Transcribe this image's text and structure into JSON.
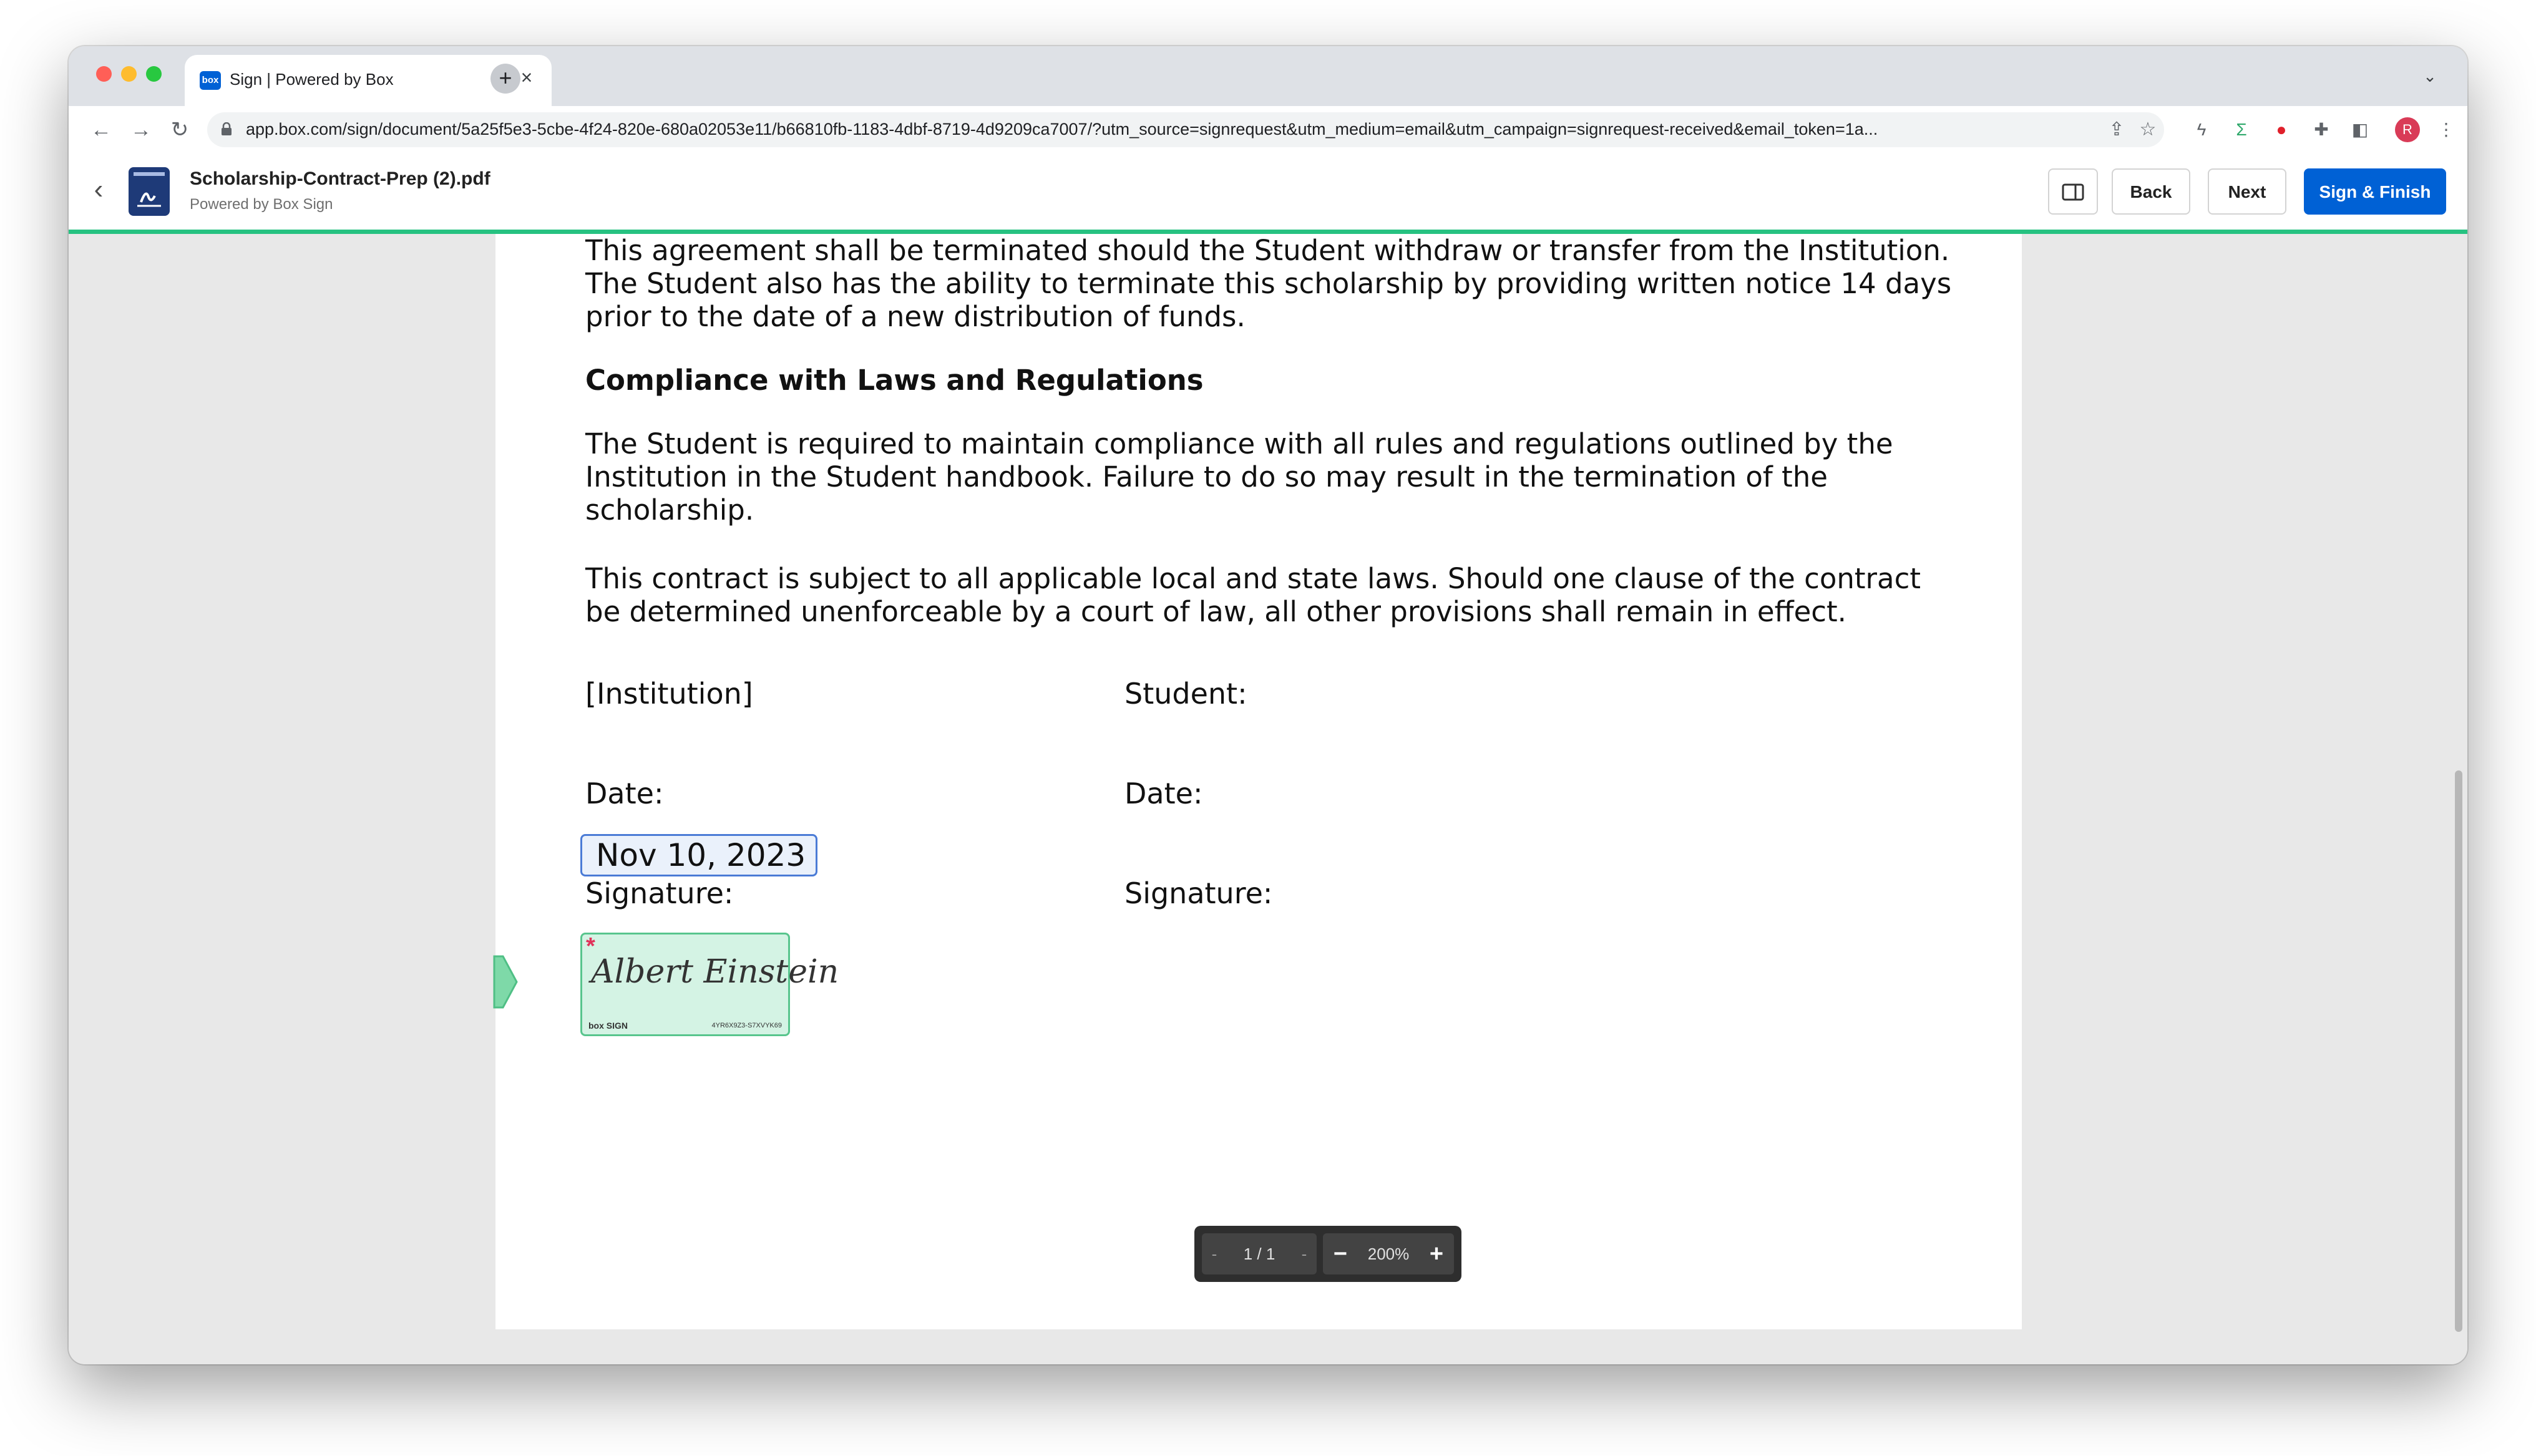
{
  "browser": {
    "tab_title": "Sign | Powered by Box",
    "favicon_text": "box",
    "url": "app.box.com/sign/document/5a25f5e3-5cbe-4f24-820e-680a02053e11/b66810fb-1183-4dbf-8719-4d9209ca7007/?utm_source=signrequest&utm_medium=email&utm_campaign=signrequest-received&email_token=1a...",
    "profile_initial": "R"
  },
  "header": {
    "doc_title": "Scholarship-Contract-Prep (2).pdf",
    "doc_subtitle": "Powered by Box Sign",
    "back_label": "Back",
    "next_label": "Next",
    "finish_label": "Sign & Finish",
    "accent_color": "#26c281",
    "primary_color": "#0061d5"
  },
  "document": {
    "para1_lines": [
      "This agreement shall be terminated should the Student withdraw or transfer from the Institution.",
      "The Student also has the ability to terminate this scholarship by providing written notice 14 days",
      "prior to the date of a new distribution of funds."
    ],
    "heading": "Compliance with Laws and Regulations",
    "para2_lines": [
      "The Student is required to maintain compliance with all rules and regulations outlined by the",
      "Institution in the Student handbook. Failure to do so may result in the termination of the",
      "scholarship."
    ],
    "para3_lines": [
      "This contract is subject to all applicable local and state laws. Should one clause of the contract",
      "be determined unenforceable by a court of law, all other provisions shall remain in effect."
    ],
    "institution_label": "[Institution]",
    "student_label": "Student:",
    "date_label_left": "Date:",
    "date_label_right": "Date:",
    "date_value": "Nov 10, 2023",
    "signature_label_left": "Signature:",
    "signature_label_right": "Signature:",
    "signature_name": "Albert Einstein",
    "signature_brand": "box SIGN",
    "signature_code": "4YR6X9Z3-S7XVYK69"
  },
  "viewer": {
    "page_indicator": "1 / 1",
    "zoom_level": "200%"
  }
}
